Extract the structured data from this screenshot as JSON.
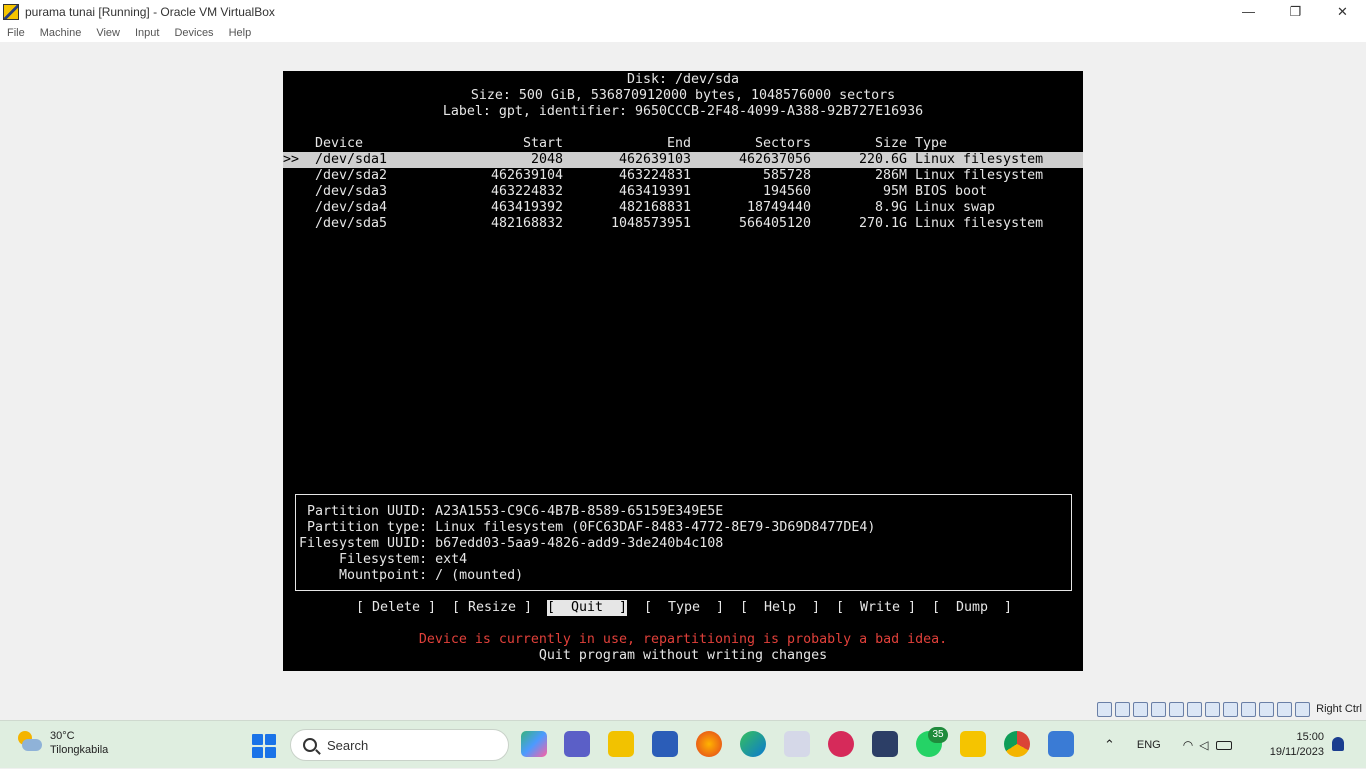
{
  "window": {
    "title": "purama tunai [Running] - Oracle VM VirtualBox",
    "minimize": "—",
    "restore": "❐",
    "close": "✕"
  },
  "menu": [
    "File",
    "Machine",
    "View",
    "Input",
    "Devices",
    "Help"
  ],
  "cfdisk": {
    "disk_line": "Disk: /dev/sda",
    "size_line": "Size: 500 GiB, 536870912000 bytes, 1048576000 sectors",
    "label_line": "Label: gpt, identifier: 9650CCCB-2F48-4099-A388-92B727E16936",
    "headers": {
      "device": "Device",
      "start": "Start",
      "end": "End",
      "sectors": "Sectors",
      "size": "Size",
      "type": "Type"
    },
    "cursor": ">>",
    "partitions": [
      {
        "device": "/dev/sda1",
        "start": "2048",
        "end": "462639103",
        "sectors": "462637056",
        "size": "220.6G",
        "type": "Linux filesystem"
      },
      {
        "device": "/dev/sda2",
        "start": "462639104",
        "end": "463224831",
        "sectors": "585728",
        "size": "286M",
        "type": "Linux filesystem"
      },
      {
        "device": "/dev/sda3",
        "start": "463224832",
        "end": "463419391",
        "sectors": "194560",
        "size": "95M",
        "type": "BIOS boot"
      },
      {
        "device": "/dev/sda4",
        "start": "463419392",
        "end": "482168831",
        "sectors": "18749440",
        "size": "8.9G",
        "type": "Linux swap"
      },
      {
        "device": "/dev/sda5",
        "start": "482168832",
        "end": "1048573951",
        "sectors": "566405120",
        "size": "270.1G",
        "type": "Linux filesystem"
      }
    ],
    "info": {
      "partition_uuid": " Partition UUID: A23A1553-C9C6-4B7B-8589-65159E349E5E",
      "partition_type": " Partition type: Linux filesystem (0FC63DAF-8483-4772-8E79-3D69D8477DE4)",
      "filesystem_uuid": "Filesystem UUID: b67edd03-5aa9-4826-add9-3de240b4c108",
      "filesystem": "     Filesystem: ext4",
      "mountpoint": "     Mountpoint: / (mounted)"
    },
    "actions": {
      "delete": "[ Delete ]",
      "resize": "[ Resize ]",
      "quit": "[  Quit  ]",
      "type": "[  Type  ]",
      "help": "[  Help  ]",
      "write": "[  Write ]",
      "dump": "[  Dump  ]"
    },
    "warning": "Device is currently in use, repartitioning is probably a bad idea.",
    "hint": "Quit program without writing changes"
  },
  "statusbar": {
    "host_key": "Right Ctrl"
  },
  "taskbar": {
    "weather_temp": "30°C",
    "weather_location": "Tilongkabila",
    "search_placeholder": "Search",
    "whatsapp_badge": "35",
    "language": "ENG",
    "time": "15:00",
    "date": "19/11/2023"
  }
}
